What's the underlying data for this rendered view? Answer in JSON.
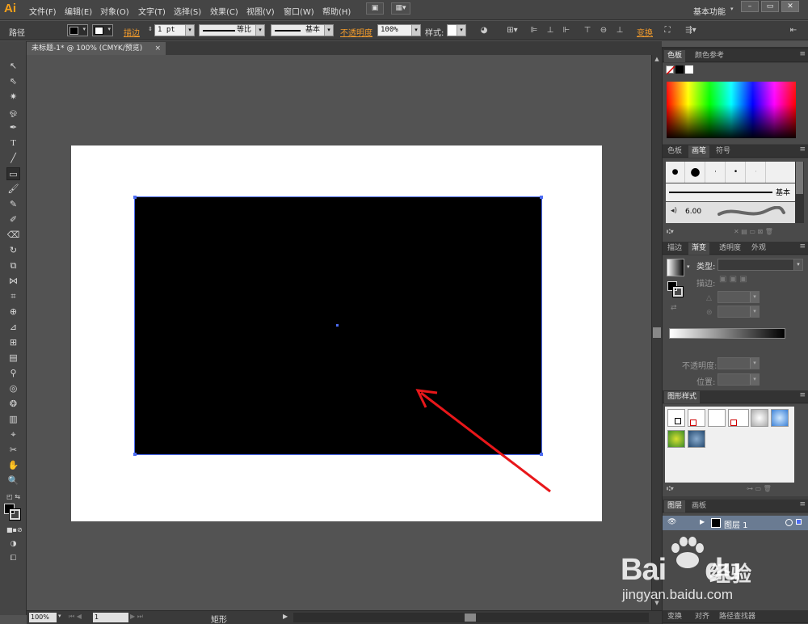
{
  "app": {
    "logo": "Ai",
    "workspace": "基本功能"
  },
  "menu": [
    "文件(F)",
    "编辑(E)",
    "对象(O)",
    "文字(T)",
    "选择(S)",
    "效果(C)",
    "视图(V)",
    "窗口(W)",
    "帮助(H)"
  ],
  "window_buttons": {
    "minimize": "–",
    "restore": "▭",
    "close": "✕"
  },
  "control": {
    "selection_type": "路径",
    "stroke_link": "描边",
    "stroke_weight": "1 pt",
    "profile_label": "等比",
    "brush_label": "基本",
    "opacity_link": "不透明度",
    "opacity_value": "100%",
    "style_label": "样式:",
    "transform_link": "变换"
  },
  "document": {
    "tab_title": "未标题-1* @ 100% (CMYK/预览)",
    "close": "×"
  },
  "status": {
    "zoom": "100%",
    "page": "1",
    "tool": "矩形"
  },
  "panels": {
    "color": {
      "tabs": [
        "色板",
        "颜色参考"
      ],
      "active": "色板"
    },
    "brush": {
      "tabs": [
        "色板",
        "画笔",
        "符号"
      ],
      "active": "画笔",
      "basic": "基本",
      "size": "6.00"
    },
    "gradient": {
      "tabs": [
        "描边",
        "渐变",
        "透明度",
        "外观"
      ],
      "active": "渐变",
      "type_label": "类型:",
      "stroke_label": "描边:",
      "opacity_label": "不透明度:",
      "position_label": "位置:"
    },
    "graphic_styles": {
      "tab": "图形样式"
    },
    "layers": {
      "tabs": [
        "图层",
        "画板"
      ],
      "active": "图层",
      "layer_name": "图层 1"
    },
    "bottom": {
      "tabs": [
        "变换",
        "对齐",
        "路径查找器"
      ]
    }
  },
  "watermark": {
    "brand": "Bai",
    "brand2": "du",
    "cn": "经验",
    "url": "jingyan.baidu.com"
  },
  "colors": {
    "accent_orange": "#f09a2c",
    "selection_blue": "#4d6cf2",
    "arrow_red": "#e8171a"
  }
}
